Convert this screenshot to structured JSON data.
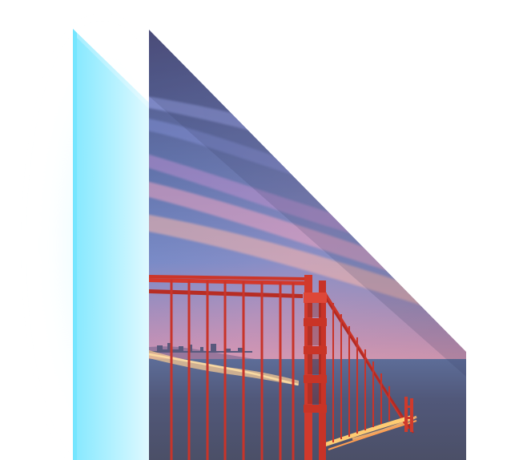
{
  "scene": {
    "subject": "golden-gate-bridge-photo",
    "glass_panel_color": "#8fe9ff",
    "glass_glow_color": "#bff4ff",
    "sky_top_color": "#5a5d8e",
    "sky_mid_color": "#5a79b8",
    "sky_pink_color": "#d88aa4",
    "sky_horizon_color": "#f3b08b",
    "water_color": "#4e5674",
    "bridge_color": "#c7352a",
    "bridge_light_color": "#ffd27a",
    "city_light_color": "#ffe1a6"
  }
}
